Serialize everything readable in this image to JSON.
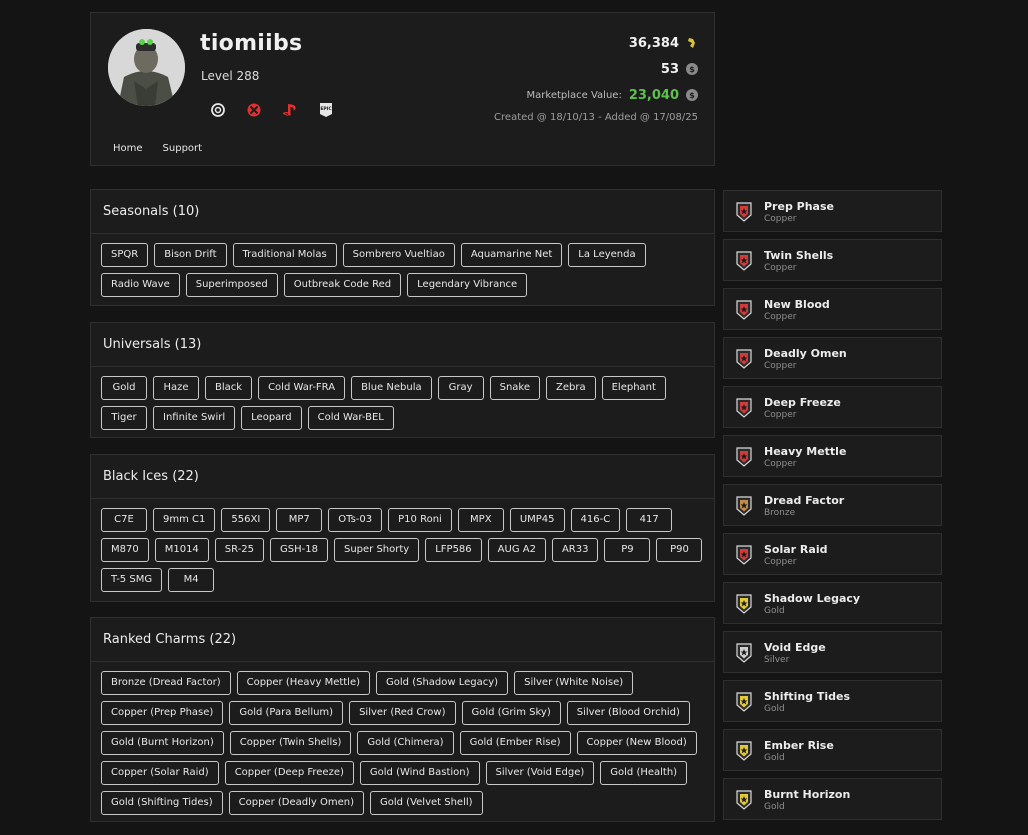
{
  "profile": {
    "username": "tiomiibs",
    "level": "Level 288",
    "renown": "36,384",
    "credits": "53",
    "marketplace_label": "Marketplace Value:",
    "marketplace_value": "23,040",
    "created": "Created @ 18/10/13 - Added @ 17/08/25",
    "platforms": [
      "ubisoft-icon",
      "xbox-icon",
      "playstation-icon",
      "epic-games-icon"
    ],
    "nav": {
      "home": "Home",
      "support": "Support"
    }
  },
  "colors": {
    "background": "#141414",
    "panel": "#1c1c1c",
    "accent_green": "#5fbf4f",
    "copper": "#d33b3b",
    "bronze": "#c38a4a",
    "gold": "#e2c93a",
    "silver": "#cfcfcf"
  },
  "sections": {
    "seasonals": {
      "title": "Seasonals (10)",
      "items": [
        "SPQR",
        "Bison Drift",
        "Traditional Molas",
        "Sombrero Vueltiao",
        "Aquamarine Net",
        "La Leyenda",
        "Radio Wave",
        "Superimposed",
        "Outbreak Code Red",
        "Legendary Vibrance"
      ]
    },
    "universals": {
      "title": "Universals (13)",
      "items": [
        "Gold",
        "Haze",
        "Black",
        "Cold War-FRA",
        "Blue Nebula",
        "Gray",
        "Snake",
        "Zebra",
        "Elephant",
        "Tiger",
        "Infinite Swirl",
        "Leopard",
        "Cold War-BEL"
      ]
    },
    "black_ices": {
      "title": "Black Ices (22)",
      "items": [
        "C7E",
        "9mm C1",
        "556XI",
        "MP7",
        "OTs-03",
        "P10 Roni",
        "MPX",
        "UMP45",
        "416-C",
        "417",
        "M870",
        "M1014",
        "SR-25",
        "GSH-18",
        "Super Shorty",
        "LFP586",
        "AUG A2",
        "AR33",
        "P9",
        "P90",
        "T-5 SMG",
        "M4"
      ]
    },
    "ranked_charms": {
      "title": "Ranked Charms (22)",
      "items": [
        "Bronze (Dread Factor)",
        "Copper (Heavy Mettle)",
        "Gold (Shadow Legacy)",
        "Silver (White Noise)",
        "Copper (Prep Phase)",
        "Gold (Para Bellum)",
        "Silver (Red Crow)",
        "Gold (Grim Sky)",
        "Silver (Blood Orchid)",
        "Gold (Burnt Horizon)",
        "Copper (Twin Shells)",
        "Gold (Chimera)",
        "Gold (Ember Rise)",
        "Copper (New Blood)",
        "Copper (Solar Raid)",
        "Copper (Deep Freeze)",
        "Gold (Wind Bastion)",
        "Silver (Void Edge)",
        "Gold (Health)",
        "Gold (Shifting Tides)",
        "Copper (Deadly Omen)",
        "Gold (Velvet Shell)"
      ]
    }
  },
  "ranked_history": [
    {
      "season": "Prep Phase",
      "rank": "Copper",
      "icon": "copper-rank-icon"
    },
    {
      "season": "Twin Shells",
      "rank": "Copper",
      "icon": "copper-rank-icon"
    },
    {
      "season": "New Blood",
      "rank": "Copper",
      "icon": "copper-rank-icon"
    },
    {
      "season": "Deadly Omen",
      "rank": "Copper",
      "icon": "copper-rank-icon"
    },
    {
      "season": "Deep Freeze",
      "rank": "Copper",
      "icon": "copper-rank-icon"
    },
    {
      "season": "Heavy Mettle",
      "rank": "Copper",
      "icon": "copper-rank-icon"
    },
    {
      "season": "Dread Factor",
      "rank": "Bronze",
      "icon": "bronze-rank-icon"
    },
    {
      "season": "Solar Raid",
      "rank": "Copper",
      "icon": "copper-rank-icon"
    },
    {
      "season": "Shadow Legacy",
      "rank": "Gold",
      "icon": "gold-rank-icon"
    },
    {
      "season": "Void Edge",
      "rank": "Silver",
      "icon": "silver-rank-icon"
    },
    {
      "season": "Shifting Tides",
      "rank": "Gold",
      "icon": "gold-rank-icon"
    },
    {
      "season": "Ember Rise",
      "rank": "Gold",
      "icon": "gold-rank-icon"
    },
    {
      "season": "Burnt Horizon",
      "rank": "Gold",
      "icon": "gold-rank-icon"
    }
  ]
}
